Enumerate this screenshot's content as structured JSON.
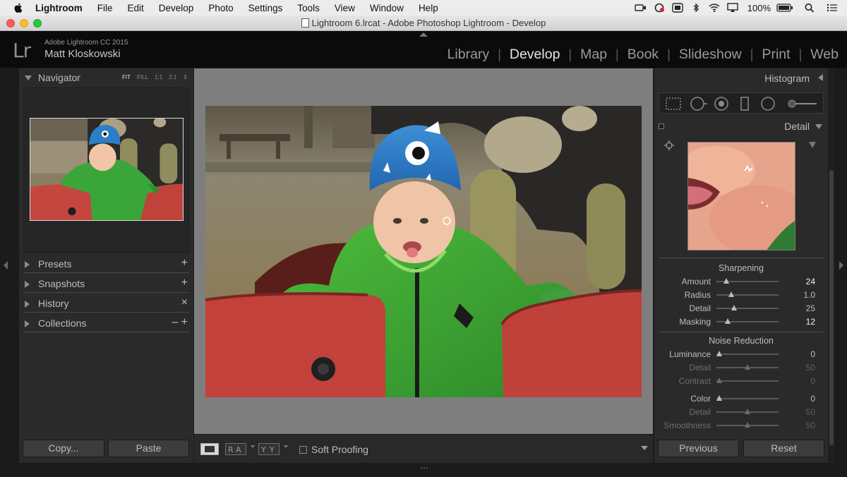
{
  "menubar": {
    "app_name": "Lightroom",
    "items": [
      "File",
      "Edit",
      "Develop",
      "Photo",
      "Settings",
      "Tools",
      "View",
      "Window",
      "Help"
    ],
    "battery": "100%"
  },
  "window": {
    "title": "Lightroom 6.lrcat - Adobe Photoshop Lightroom - Develop"
  },
  "identity": {
    "product": "Adobe Lightroom CC 2015",
    "user": "Matt Kloskowski",
    "logo": "Lr"
  },
  "modules": [
    "Library",
    "Develop",
    "Map",
    "Book",
    "Slideshow",
    "Print",
    "Web"
  ],
  "active_module": "Develop",
  "left_panel": {
    "navigator": {
      "label": "Navigator",
      "zoom": [
        "FIT",
        "FILL",
        "1:1",
        "2:1"
      ],
      "zoom_active": "FIT"
    },
    "panels": [
      {
        "label": "Presets",
        "action": "+"
      },
      {
        "label": "Snapshots",
        "action": "+"
      },
      {
        "label": "History",
        "action": "×"
      },
      {
        "label": "Collections",
        "action": "– +"
      }
    ],
    "copy_label": "Copy...",
    "paste_label": "Paste"
  },
  "toolbar": {
    "soft_proofing_label": "Soft Proofing",
    "soft_proofing_checked": false
  },
  "right_panel": {
    "histogram_label": "Histogram",
    "detail_label": "Detail",
    "sharpening": {
      "title": "Sharpening",
      "sliders": [
        {
          "label": "Amount",
          "value": "24",
          "fraction": 0.16,
          "highlight": true
        },
        {
          "label": "Radius",
          "value": "1.0",
          "fraction": 0.24,
          "highlight": false
        },
        {
          "label": "Detail",
          "value": "25",
          "fraction": 0.28,
          "highlight": false
        },
        {
          "label": "Masking",
          "value": "12",
          "fraction": 0.18,
          "highlight": true
        }
      ]
    },
    "noise_reduction": {
      "title": "Noise Reduction",
      "sliders": [
        {
          "label": "Luminance",
          "value": "0",
          "fraction": 0.05,
          "dim": false
        },
        {
          "label": "Detail",
          "value": "50",
          "fraction": 0.5,
          "dim": true
        },
        {
          "label": "Contrast",
          "value": "0",
          "fraction": 0.05,
          "dim": true
        },
        {
          "label": "Color",
          "value": "0",
          "fraction": 0.05,
          "dim": false
        },
        {
          "label": "Detail",
          "value": "50",
          "fraction": 0.5,
          "dim": true
        },
        {
          "label": "Smoothness",
          "value": "50",
          "fraction": 0.5,
          "dim": true
        }
      ]
    },
    "previous_label": "Previous",
    "reset_label": "Reset"
  },
  "colors": {
    "accent_red": "#d23b3b",
    "panel_bg": "#2a2a2a",
    "canvas_bg": "#7e7e7e"
  }
}
